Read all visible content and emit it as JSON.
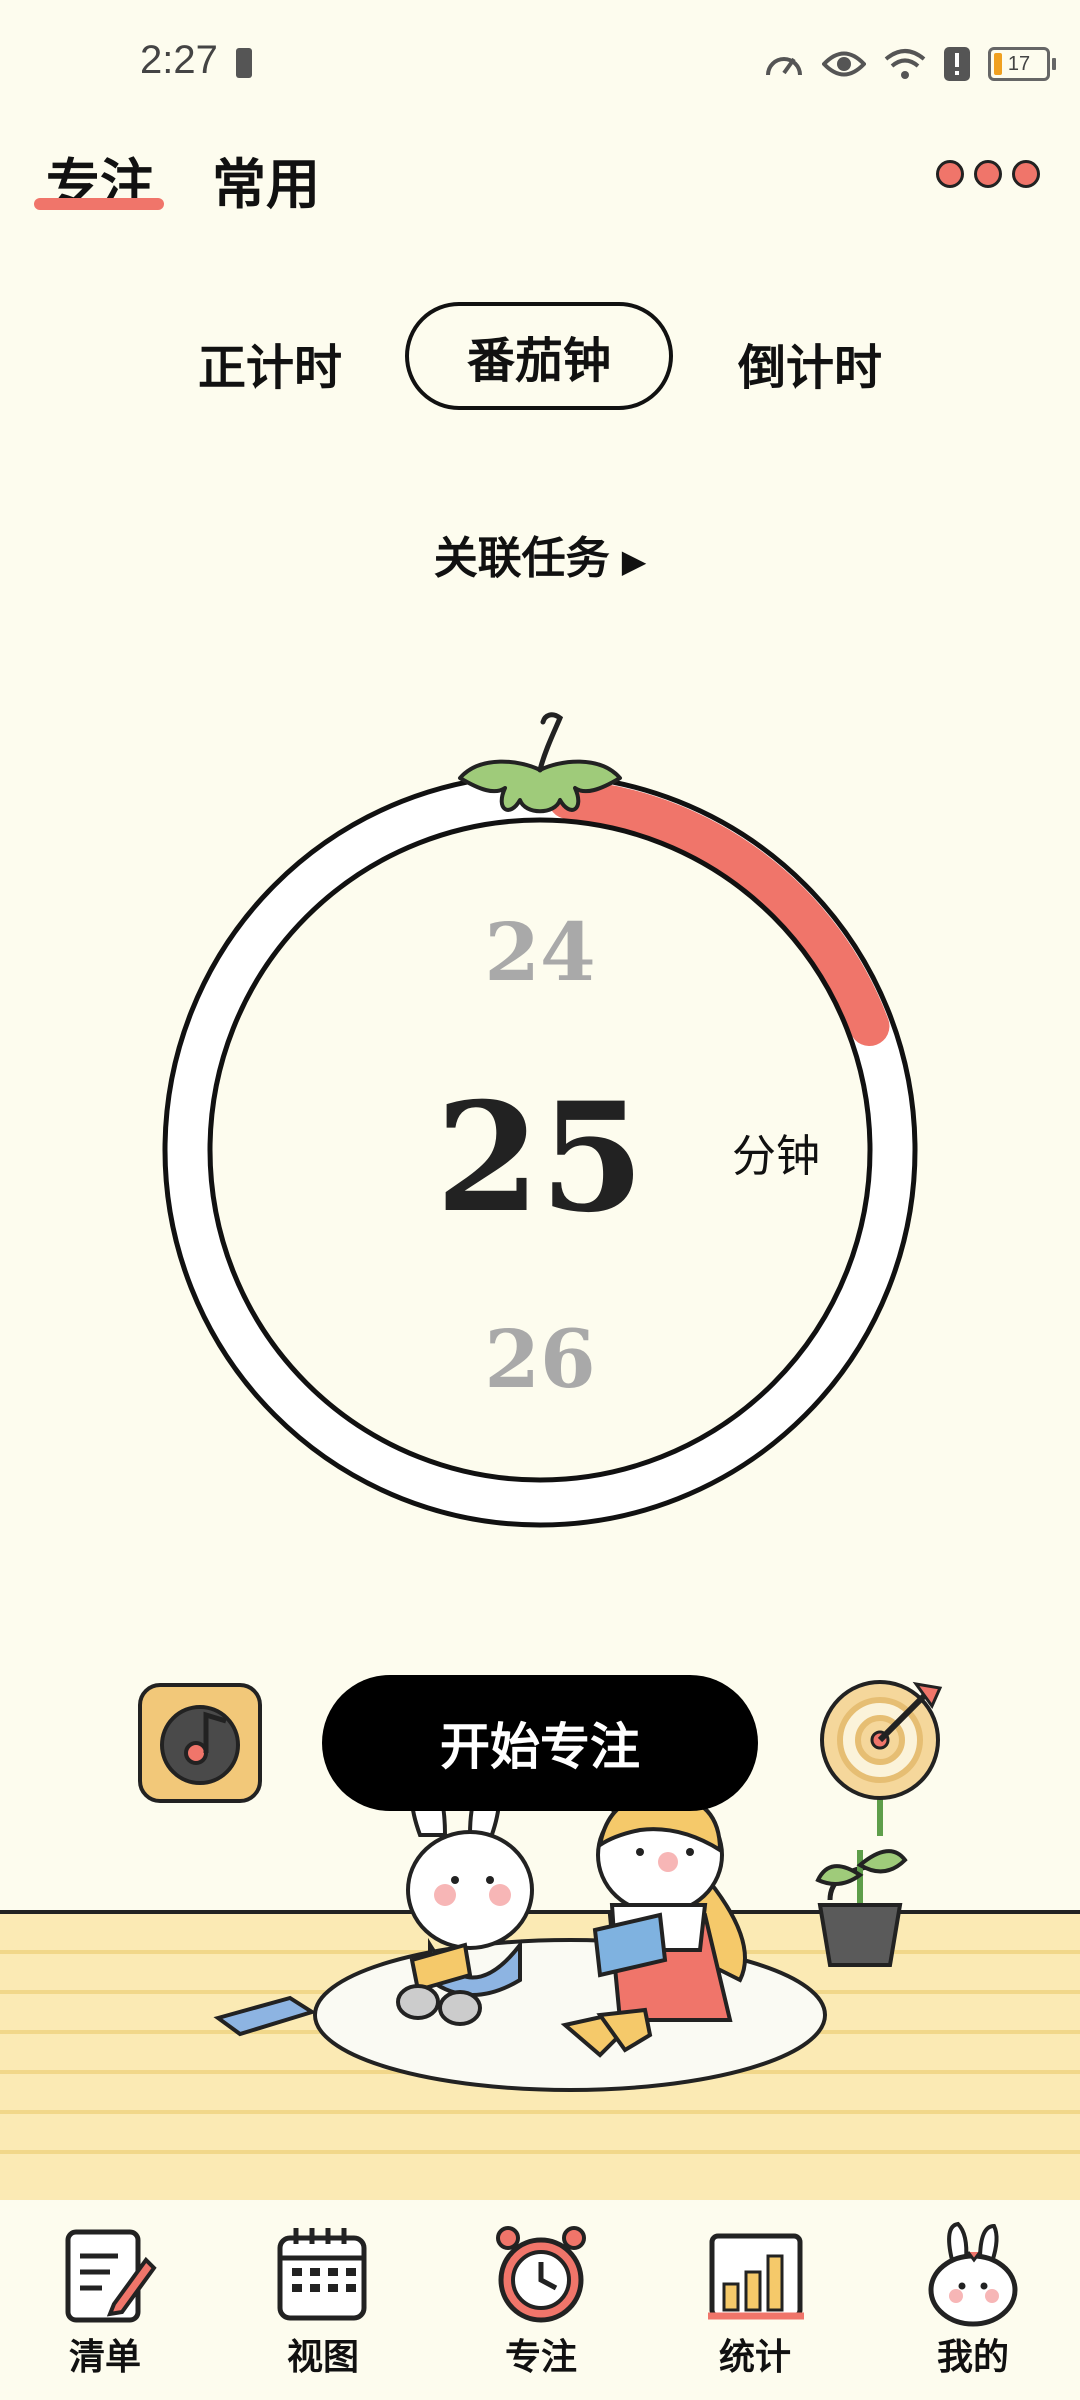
{
  "status": {
    "time": "2:27",
    "battery": "17"
  },
  "header": {
    "tabs": [
      "专注",
      "常用"
    ]
  },
  "modes": {
    "left": "正计时",
    "active": "番茄钟",
    "right": "倒计时"
  },
  "related_task": "关联任务",
  "dial": {
    "prev": "24",
    "current": "25",
    "next": "26",
    "unit": "分钟",
    "progress": 0.18
  },
  "actions": {
    "start": "开始专注"
  },
  "nav": [
    "清单",
    "视图",
    "专注",
    "统计",
    "我的"
  ],
  "colors": {
    "accent": "#F0756A",
    "background": "#FDFCEE",
    "floor": "#FBEAB4"
  }
}
